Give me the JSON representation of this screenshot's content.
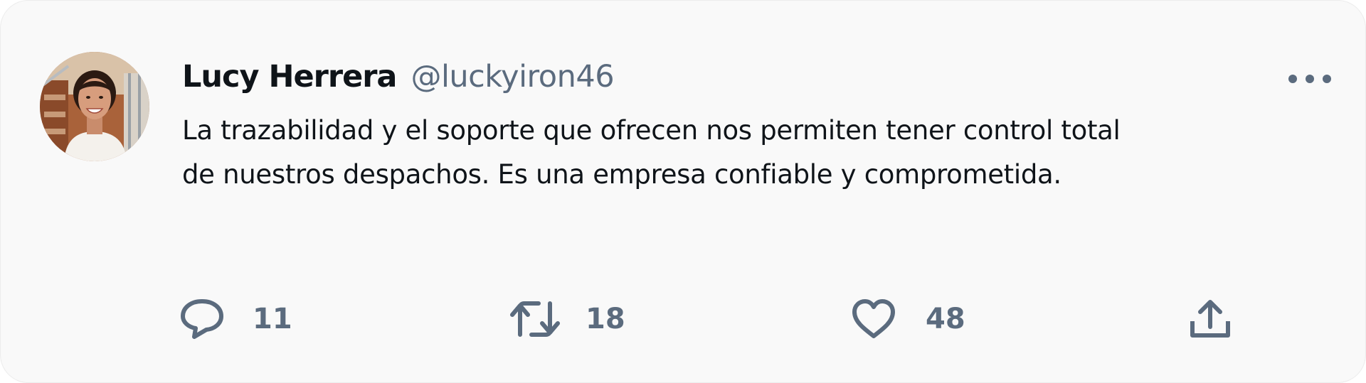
{
  "tweet": {
    "author_name": "Lucy Herrera",
    "author_handle": "@luckyiron46",
    "text_line1": "La trazabilidad y el soporte que ofrecen nos permiten tener control total",
    "text_line2": "de nuestros despachos. Es una empresa confiable y comprometida.",
    "avatar_icon": "avatar-photo"
  },
  "actions": {
    "reply": {
      "icon": "reply-icon",
      "count": "11"
    },
    "retweet": {
      "icon": "retweet-icon",
      "count": "18"
    },
    "like": {
      "icon": "heart-icon",
      "count": "48"
    },
    "share": {
      "icon": "share-icon"
    }
  },
  "menu": {
    "icon": "more-options-icon"
  },
  "colors": {
    "card_background": "#f9f9f9",
    "text_primary": "#0f1419",
    "text_secondary": "#5b6b7e"
  }
}
